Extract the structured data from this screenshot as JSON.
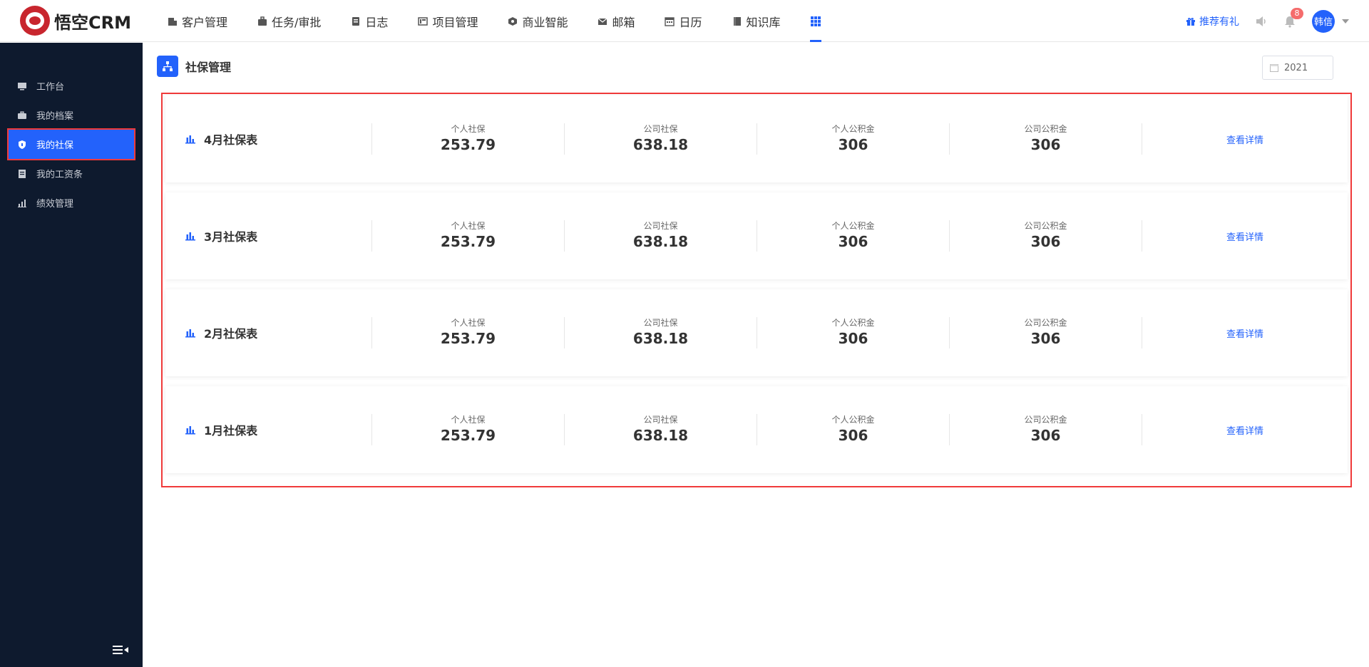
{
  "app": {
    "name": "悟空CRM"
  },
  "topnav": [
    {
      "label": "客户管理",
      "icon": "customer-icon"
    },
    {
      "label": "任务/审批",
      "icon": "briefcase-icon"
    },
    {
      "label": "日志",
      "icon": "log-icon"
    },
    {
      "label": "项目管理",
      "icon": "project-icon"
    },
    {
      "label": "商业智能",
      "icon": "bi-icon"
    },
    {
      "label": "邮箱",
      "icon": "mail-icon"
    },
    {
      "label": "日历",
      "icon": "calendar-icon"
    },
    {
      "label": "知识库",
      "icon": "book-icon"
    }
  ],
  "topright": {
    "gift_label": "推荐有礼",
    "notification_count": "8",
    "user_name": "韩信"
  },
  "sidebar": {
    "items": [
      {
        "label": "工作台",
        "icon": "monitor-icon"
      },
      {
        "label": "我的档案",
        "icon": "briefcase-icon"
      },
      {
        "label": "我的社保",
        "icon": "shield-icon",
        "active": true
      },
      {
        "label": "我的工资条",
        "icon": "payslip-icon"
      },
      {
        "label": "绩效管理",
        "icon": "chart-icon"
      }
    ]
  },
  "page": {
    "title": "社保管理",
    "year": "2021"
  },
  "cards": [
    {
      "title": "4月社保表",
      "personal_ss_label": "个人社保",
      "personal_ss": "253.79",
      "company_ss_label": "公司社保",
      "company_ss": "638.18",
      "personal_hf_label": "个人公积金",
      "personal_hf": "306",
      "company_hf_label": "公司公积金",
      "company_hf": "306",
      "link": "查看详情"
    },
    {
      "title": "3月社保表",
      "personal_ss_label": "个人社保",
      "personal_ss": "253.79",
      "company_ss_label": "公司社保",
      "company_ss": "638.18",
      "personal_hf_label": "个人公积金",
      "personal_hf": "306",
      "company_hf_label": "公司公积金",
      "company_hf": "306",
      "link": "查看详情"
    },
    {
      "title": "2月社保表",
      "personal_ss_label": "个人社保",
      "personal_ss": "253.79",
      "company_ss_label": "公司社保",
      "company_ss": "638.18",
      "personal_hf_label": "个人公积金",
      "personal_hf": "306",
      "company_hf_label": "公司公积金",
      "company_hf": "306",
      "link": "查看详情"
    },
    {
      "title": "1月社保表",
      "personal_ss_label": "个人社保",
      "personal_ss": "253.79",
      "company_ss_label": "公司社保",
      "company_ss": "638.18",
      "personal_hf_label": "个人公积金",
      "personal_hf": "306",
      "company_hf_label": "公司公积金",
      "company_hf": "306",
      "link": "查看详情"
    }
  ]
}
